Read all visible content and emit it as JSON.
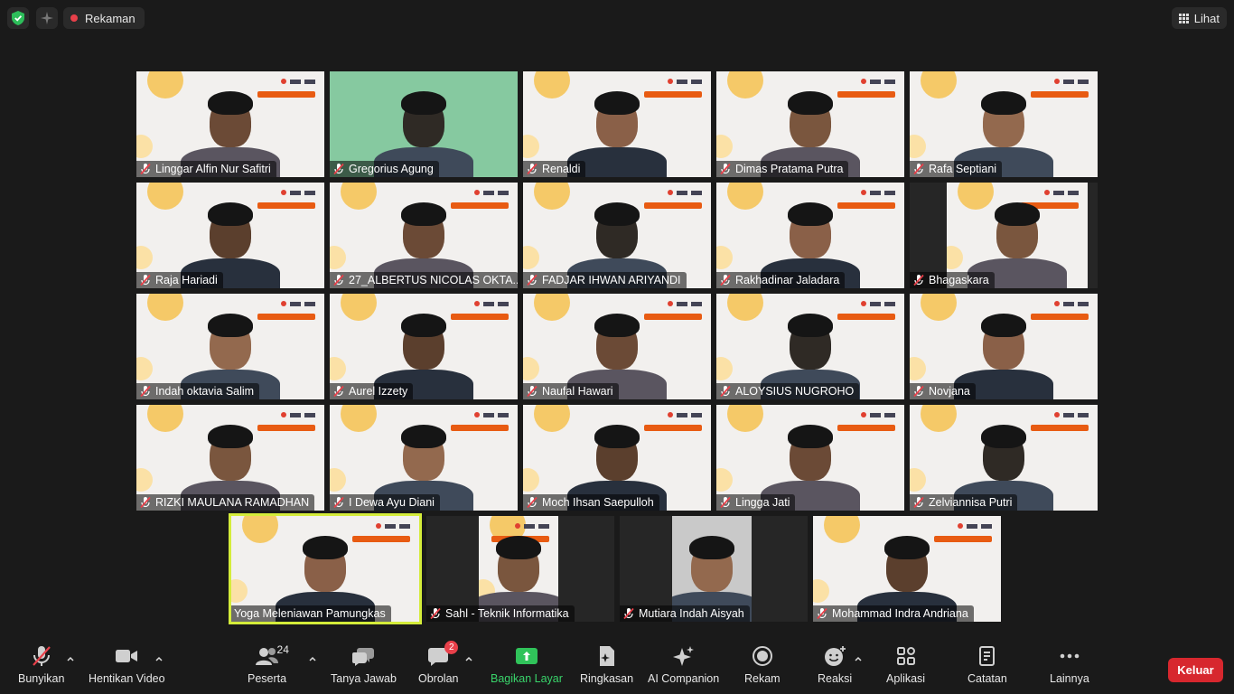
{
  "topbar": {
    "recording_label": "Rekaman",
    "view_label": "Lihat",
    "security_icon": "shield-check-icon",
    "ai_icon": "sparkle-icon",
    "record_color": "#e8404a"
  },
  "participants": [
    {
      "name": "Linggar Alfin Nur Safitri",
      "muted": true
    },
    {
      "name": "Gregorius Agung",
      "muted": true
    },
    {
      "name": "Renaldi",
      "muted": true
    },
    {
      "name": "Dimas Pratama Putra",
      "muted": true
    },
    {
      "name": "Rafa Septiani",
      "muted": true
    },
    {
      "name": "Raja Hariadi",
      "muted": true
    },
    {
      "name": "27_ALBERTUS NICOLAS OKTA...",
      "muted": true
    },
    {
      "name": "FADJAR IHWAN ARIYANDI",
      "muted": true
    },
    {
      "name": "Rakhadinar Jaladara",
      "muted": true
    },
    {
      "name": "Bhagaskara",
      "muted": true
    },
    {
      "name": "Indah oktavia Salim",
      "muted": true
    },
    {
      "name": "Aurel Izzety",
      "muted": true
    },
    {
      "name": "Naufal Hawari",
      "muted": true
    },
    {
      "name": "ALOYSIUS NUGROHO",
      "muted": true
    },
    {
      "name": "Novjana",
      "muted": true
    },
    {
      "name": "RIZKI MAULANA RAMADHAN",
      "muted": true
    },
    {
      "name": "I Dewa Ayu Diani",
      "muted": true
    },
    {
      "name": "Moch Ihsan Saepulloh",
      "muted": true
    },
    {
      "name": "Lingga Jati",
      "muted": true
    },
    {
      "name": "Zelviannisa Putri",
      "muted": true
    },
    {
      "name": "Yoga Meleniawan Pamungkas",
      "muted": false,
      "active_speaker": true
    },
    {
      "name": "Sahl - Teknik Informatika",
      "muted": true
    },
    {
      "name": "Mutiara Indah Aisyah",
      "muted": true
    },
    {
      "name": "Mohammad Indra Andriana",
      "muted": true
    }
  ],
  "toolbar": {
    "unmute": "Bunyikan",
    "stop_video": "Hentikan Video",
    "participants": "Peserta",
    "participants_count": "24",
    "qa": "Tanya Jawab",
    "chat": "Obrolan",
    "chat_badge": "2",
    "share": "Bagikan Layar",
    "summary": "Ringkasan",
    "ai_companion": "AI Companion",
    "record": "Rekam",
    "reactions": "Reaksi",
    "apps": "Aplikasi",
    "notes": "Catatan",
    "more": "Lainnya",
    "leave": "Keluar",
    "share_color": "#30c35a",
    "leave_color": "#d7272e"
  }
}
